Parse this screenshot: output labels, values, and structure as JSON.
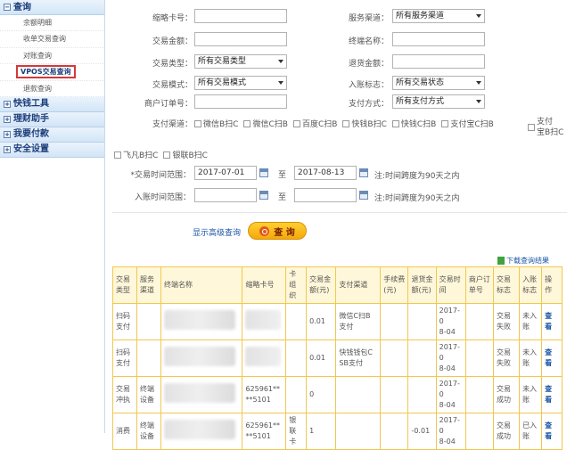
{
  "sidebar": {
    "query": {
      "label": "查询",
      "children": [
        "余额明细",
        "收单交易查询",
        "对账查询",
        "VPOS交易查询",
        "退款查询"
      ]
    },
    "sections": [
      "快钱工具",
      "理财助手",
      "我要付款",
      "安全设置"
    ]
  },
  "form": {
    "card_no": "缩略卡号：",
    "service_channel": "服务渠道：",
    "service_channel_value": "所有服务渠道",
    "amount": "交易金额：",
    "terminal_name": "终端名称：",
    "txn_type": "交易类型：",
    "txn_type_value": "所有交易类型",
    "refund_amount": "退货金额：",
    "txn_mode": "交易模式：",
    "txn_mode_value": "所有交易模式",
    "entry_flag": "入账标志：",
    "entry_flag_value": "所有交易状态",
    "merchant_order": "商户订单号：",
    "pay_method": "支付方式：",
    "pay_method_value": "所有支付方式",
    "pay_channel": "支付渠道：",
    "channels": [
      "微信B扫C",
      "微信C扫B",
      "百度C扫B",
      "快钱B扫C",
      "快钱C扫B",
      "支付宝C扫B"
    ],
    "channel_last": [
      "支付",
      "宝B扫C"
    ],
    "channels2": [
      "飞凡B扫C",
      "银联B扫C"
    ],
    "txn_time": "*交易时间范围：",
    "txn_from": "2017-07-01",
    "to": "至",
    "txn_to": "2017-08-13",
    "note": "注:时间跨度为90天之内",
    "entry_time": "入账时间范围："
  },
  "advanced": "显示高级查询",
  "query_btn": "查 询",
  "download": "下载查询结果",
  "table": {
    "headers": [
      [
        "交易",
        "类型"
      ],
      [
        "服务",
        "渠道"
      ],
      [
        "终端名称"
      ],
      [
        "缩略卡号"
      ],
      [
        "卡组",
        "织"
      ],
      [
        "交易金",
        "额(元)"
      ],
      [
        "支付渠道"
      ],
      [
        "手续费",
        "(元)"
      ],
      [
        "退货金",
        "额(元)"
      ],
      [
        "交易时",
        "间"
      ],
      [
        "商户订",
        "单号"
      ],
      [
        "交易",
        "标志"
      ],
      [
        "入账",
        "标志"
      ],
      [
        "操",
        "作"
      ]
    ],
    "rows": [
      [
        "扫码|支付",
        "",
        "",
        "",
        "",
        "0.01",
        "微信C扫B|支付",
        "",
        "",
        "2017-0|8-04",
        "",
        "交易|失败",
        "未入|账",
        "查|看"
      ],
      [
        "扫码|支付",
        "",
        "",
        "",
        "",
        "0.01",
        "快钱钱包C|SB支付",
        "",
        "",
        "2017-0|8-04",
        "",
        "交易|失败",
        "未入|账",
        "查|看"
      ],
      [
        "交易|冲执",
        "终端|设备",
        "",
        "625961**|**5101",
        "",
        "0",
        "",
        "",
        "",
        "2017-0|8-04",
        "",
        "交易|成功",
        "未入|账",
        "查|看"
      ],
      [
        "消费",
        "终端|设备",
        "",
        "625961**|**5101",
        "银联|卡",
        "1",
        "",
        "",
        "-0.01",
        "2017-0|8-04",
        "",
        "交易|成功",
        "已入|账",
        "查|看"
      ]
    ]
  }
}
